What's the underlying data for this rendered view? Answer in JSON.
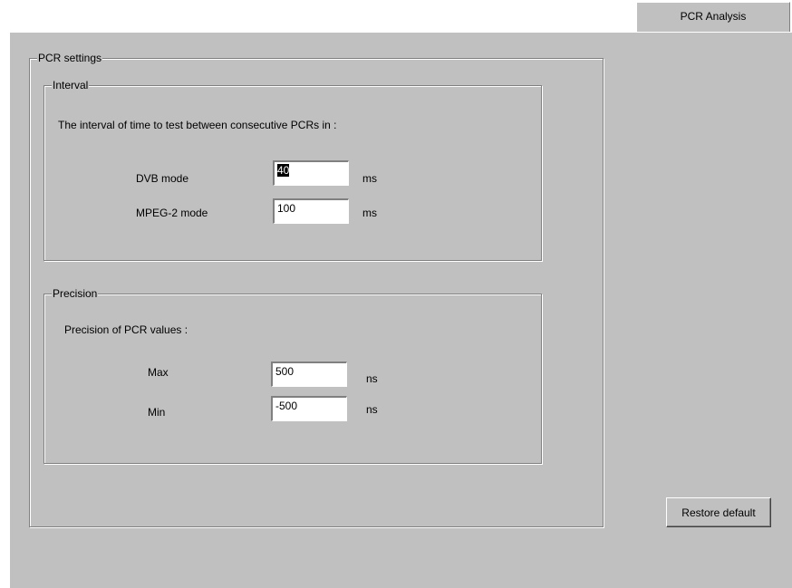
{
  "tab": {
    "label": "PCR Analysis"
  },
  "pcr_settings": {
    "title": "PCR settings",
    "interval": {
      "title": "Interval",
      "description": "The interval of time to test between  consecutive PCRs in :",
      "dvb": {
        "label": "DVB mode",
        "value": "40",
        "unit": "ms"
      },
      "mpeg2": {
        "label": "MPEG-2 mode",
        "value": "100",
        "unit": "ms"
      }
    },
    "precision": {
      "title": "Precision",
      "description": "Precision of PCR values :",
      "max": {
        "label": "Max",
        "value": "500",
        "unit": "ns"
      },
      "min": {
        "label": "Min",
        "value": "-500",
        "unit": "ns"
      }
    }
  },
  "restore_button": {
    "label": "Restore default"
  }
}
